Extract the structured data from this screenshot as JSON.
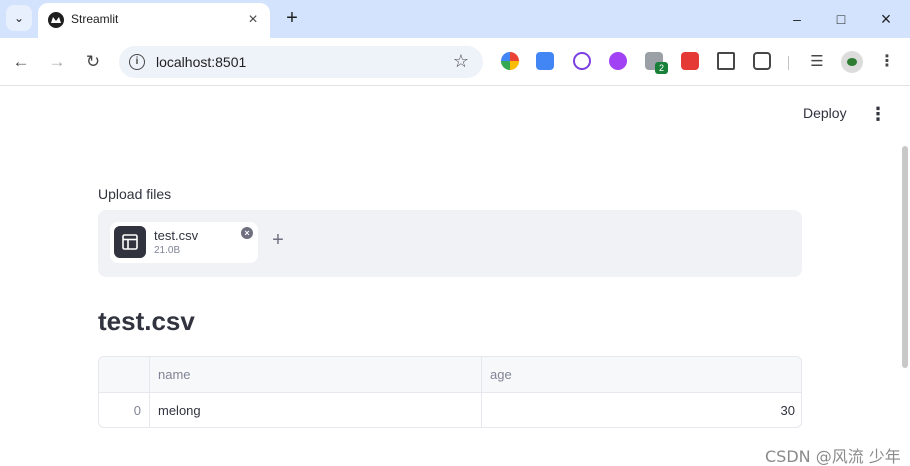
{
  "browser": {
    "tab_title": "Streamlit",
    "url": "localhost:8501",
    "extension_badge": "2"
  },
  "header": {
    "deploy_label": "Deploy"
  },
  "uploader": {
    "label": "Upload files",
    "file_name": "test.csv",
    "file_size": "21.0B"
  },
  "main": {
    "heading": "test.csv"
  },
  "table": {
    "columns": [
      "",
      "name",
      "age"
    ],
    "rows": [
      {
        "index": "0",
        "name": "melong",
        "age": "30"
      }
    ]
  },
  "watermark": "CSDN @风流 少年",
  "icons": [
    "tab-list-icon",
    "streamlit-logo-icon",
    "close-icon",
    "plus-icon",
    "minimize-icon",
    "maximize-icon",
    "back-arrow-icon",
    "forward-arrow-icon",
    "reload-icon",
    "site-info-icon",
    "bookmark-star-icon",
    "extensions-icon",
    "media-queue-icon",
    "profile-avatar-icon",
    "more-vert-icon",
    "table-file-icon",
    "remove-file-icon"
  ],
  "colors": {
    "tabbar": "#d3e3fd",
    "text": "#31333f",
    "dropzone": "#f0f2f6",
    "file_icon_bg": "#31333f"
  }
}
